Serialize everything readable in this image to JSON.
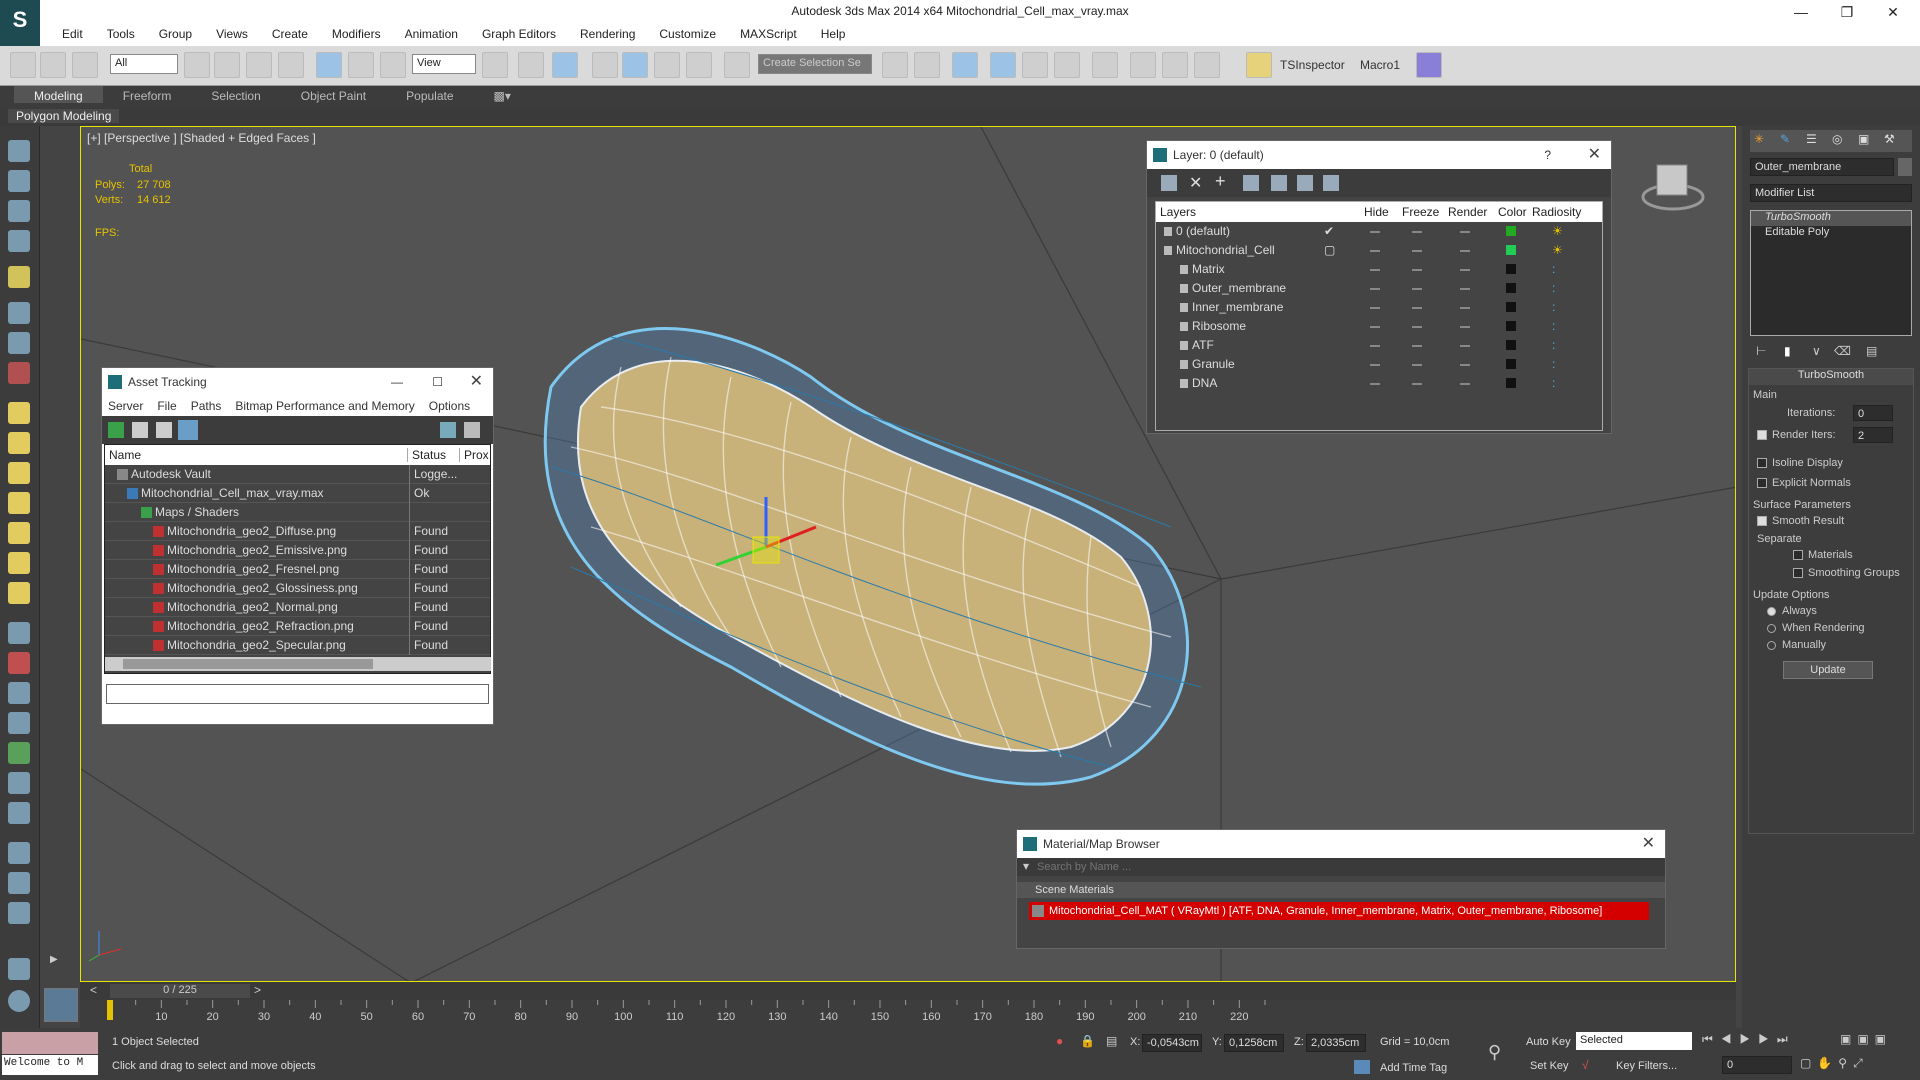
{
  "app": {
    "title": "Autodesk 3ds Max  2014 x64    Mitochondrial_Cell_max_vray.max"
  },
  "menu": [
    "Edit",
    "Tools",
    "Group",
    "Views",
    "Create",
    "Modifiers",
    "Animation",
    "Graph Editors",
    "Rendering",
    "Customize",
    "MAXScript",
    "Help"
  ],
  "toolbar": {
    "filter_value": "All",
    "ref_coord_value": "View",
    "selection_set_placeholder": "Create Selection Se",
    "tsinspector_label": "TSInspector",
    "macro_label": "Macro1"
  },
  "ribbon": {
    "tabs": [
      "Modeling",
      "Freeform",
      "Selection",
      "Object Paint",
      "Populate"
    ],
    "sub_label": "Polygon Modeling"
  },
  "viewport": {
    "label": "[+] [Perspective ] [Shaded + Edged Faces ]",
    "total_label": "Total",
    "polys_label": "Polys:",
    "polys_value": "27 708",
    "verts_label": "Verts:",
    "verts_value": "14 612",
    "fps_label": "FPS:"
  },
  "asset_tracking": {
    "title": "Asset Tracking",
    "menu": [
      "Server",
      "File",
      "Paths",
      "Bitmap Performance and Memory",
      "Options"
    ],
    "columns": [
      "Name",
      "Status",
      "Prox"
    ],
    "rows": [
      {
        "name": "Autodesk Vault",
        "status": "Logge..."
      },
      {
        "name": "Mitochondrial_Cell_max_vray.max",
        "status": "Ok"
      },
      {
        "name": "Maps / Shaders",
        "status": ""
      },
      {
        "name": "Mitochondria_geo2_Diffuse.png",
        "status": "Found"
      },
      {
        "name": "Mitochondria_geo2_Emissive.png",
        "status": "Found"
      },
      {
        "name": "Mitochondria_geo2_Fresnel.png",
        "status": "Found"
      },
      {
        "name": "Mitochondria_geo2_Glossiness.png",
        "status": "Found"
      },
      {
        "name": "Mitochondria_geo2_Normal.png",
        "status": "Found"
      },
      {
        "name": "Mitochondria_geo2_Refraction.png",
        "status": "Found"
      },
      {
        "name": "Mitochondria_geo2_Specular.png",
        "status": "Found"
      }
    ]
  },
  "layer_panel": {
    "title": "Layer: 0 (default)",
    "help": "?",
    "columns": [
      "Layers",
      "Hide",
      "Freeze",
      "Render",
      "Color",
      "Radiosity"
    ],
    "rows": [
      {
        "name": "0 (default)",
        "color": "#22aa22"
      },
      {
        "name": "Mitochondrial_Cell",
        "color": "#22cc55"
      },
      {
        "name": "Matrix",
        "color": "#111111"
      },
      {
        "name": "Outer_membrane",
        "color": "#111111"
      },
      {
        "name": "Inner_membrane",
        "color": "#111111"
      },
      {
        "name": "Ribosome",
        "color": "#111111"
      },
      {
        "name": "ATF",
        "color": "#111111"
      },
      {
        "name": "Granule",
        "color": "#111111"
      },
      {
        "name": "DNA",
        "color": "#111111"
      }
    ]
  },
  "material_browser": {
    "title": "Material/Map Browser",
    "search_placeholder": "Search by Name ...",
    "section": "Scene Materials",
    "material": "Mitochondrial_Cell_MAT  ( VRayMtl )  [ATF, DNA, Granule, Inner_membrane, Matrix, Outer_membrane, Ribosome]"
  },
  "command_panel": {
    "object_name": "Outer_membrane",
    "modifier_list": "Modifier List",
    "stack": [
      "TurboSmooth",
      "Editable Poly"
    ],
    "rollout_title": "TurboSmooth",
    "main_label": "Main",
    "iterations_label": "Iterations:",
    "iterations_value": "0",
    "render_iters_label": "Render Iters:",
    "render_iters_value": "2",
    "isoline_label": "Isoline Display",
    "explicit_normals_label": "Explicit Normals",
    "surface_params_label": "Surface Parameters",
    "smooth_result_label": "Smooth Result",
    "separate_label": "Separate",
    "materials_label": "Materials",
    "smoothing_groups_label": "Smoothing Groups",
    "update_options_label": "Update Options",
    "always_label": "Always",
    "when_rendering_label": "When Rendering",
    "manually_label": "Manually",
    "update_button": "Update"
  },
  "timeline": {
    "frame": "0 / 225",
    "ticks": [
      "10",
      "20",
      "30",
      "40",
      "50",
      "60",
      "70",
      "80",
      "90",
      "100",
      "110",
      "120",
      "130",
      "140",
      "150",
      "160",
      "170",
      "180",
      "190",
      "200",
      "210",
      "220"
    ]
  },
  "status": {
    "listener": "Welcome to M",
    "selected": "1 Object Selected",
    "prompt": "Click and drag to select and move objects",
    "x_label": "X:",
    "x_value": "-0,0543cm",
    "y_label": "Y:",
    "y_value": "0,1258cm",
    "z_label": "Z:",
    "z_value": "2,0335cm",
    "grid": "Grid = 10,0cm",
    "add_time_tag": "Add Time Tag",
    "auto_key": "Auto Key",
    "set_key": "Set Key",
    "key_mode": "Selected",
    "key_filters": "Key Filters...",
    "frame_field": "0"
  }
}
